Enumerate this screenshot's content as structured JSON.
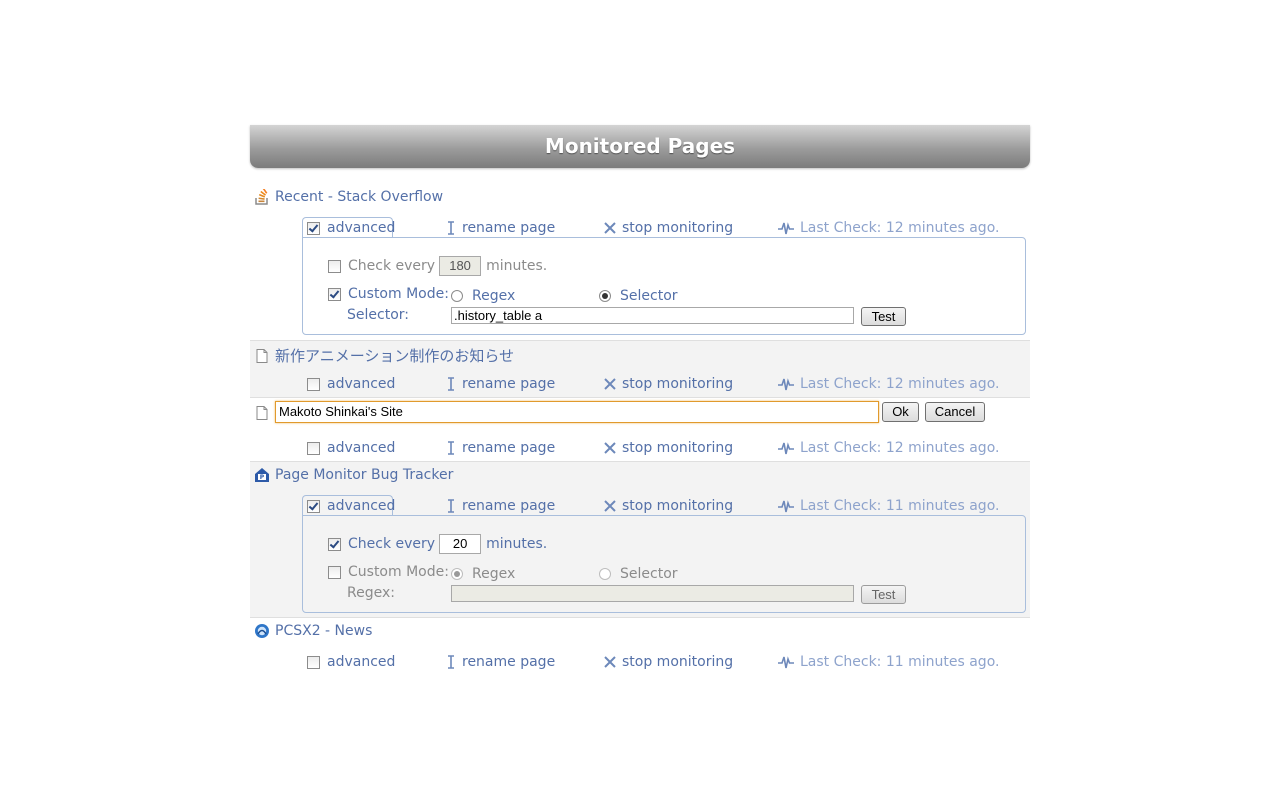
{
  "header": {
    "title": "Monitored Pages"
  },
  "actions": {
    "advanced": "advanced",
    "rename": "rename page",
    "stop": "stop monitoring"
  },
  "advanced_panel": {
    "check_every": "Check every",
    "minutes": "minutes.",
    "custom_mode": "Custom Mode:",
    "regex": "Regex",
    "selector": "Selector",
    "selector_label": "Selector:",
    "regex_label": "Regex:",
    "test": "Test"
  },
  "pages": [
    {
      "title": "Recent - Stack Overflow",
      "favicon": "stackoverflow-icon",
      "advanced_checked": true,
      "last_check": "Last Check: 12 minutes ago.",
      "check_every_checked": false,
      "check_every_value": "180",
      "custom_mode_checked": true,
      "mode": "selector",
      "field_label": "Selector:",
      "field_value": ".history_table a"
    },
    {
      "title": "新作アニメーション制作のお知らせ",
      "favicon": "page-icon",
      "advanced_checked": false,
      "last_check": "Last Check: 12 minutes ago."
    },
    {
      "title_input_value": "Makoto Shinkai's Site",
      "favicon": "page-icon",
      "ok": "Ok",
      "cancel": "Cancel",
      "advanced_checked": false,
      "last_check": "Last Check: 12 minutes ago."
    },
    {
      "title": "Page Monitor Bug Tracker",
      "favicon": "bug-tracker-icon",
      "advanced_checked": true,
      "last_check": "Last Check: 11 minutes ago.",
      "check_every_checked": true,
      "check_every_value": "20",
      "custom_mode_checked": false,
      "mode": "regex",
      "field_label": "Regex:",
      "field_value": ""
    },
    {
      "title": "PCSX2 - News",
      "favicon": "pcsx2-icon",
      "advanced_checked": false,
      "last_check": "Last Check: 11 minutes ago."
    }
  ],
  "colors": {
    "link": "#5470a8",
    "last_check": "#8ea3cc",
    "header_top": "#d4d4d4",
    "header_bottom": "#7b7b7b",
    "panel_border": "#a9bedc",
    "rename_focus": "#e19a2c"
  }
}
